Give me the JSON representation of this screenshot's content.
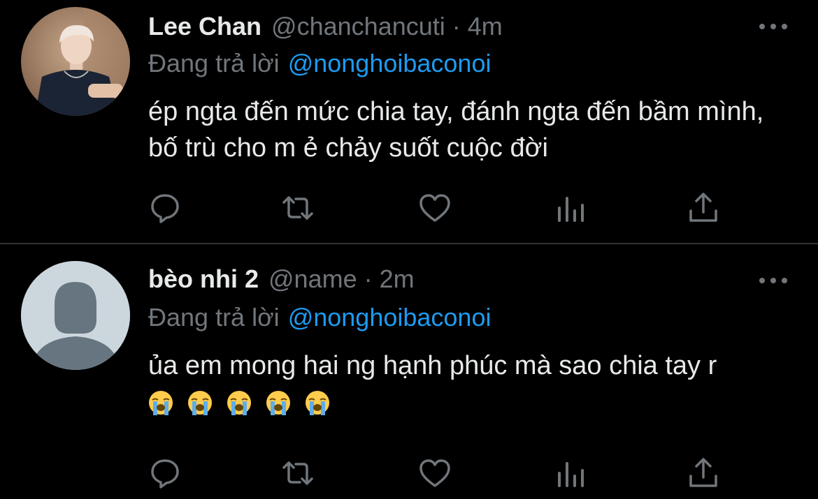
{
  "tweets": [
    {
      "name": "Lee Chan",
      "handle": "@chanchancuti",
      "separator": "·",
      "time": "4m",
      "reply_prefix": "Đang trả lời",
      "reply_to": "@nonghoibaconoi",
      "text": "ép ngta đến mức chia tay, đánh ngta đến bầm mình, bố trù cho m ẻ chảy suốt cuộc đời",
      "avatar": "profile-photo"
    },
    {
      "name": "bèo nhi 2",
      "handle": "@name",
      "separator": "·",
      "time": "2m",
      "reply_prefix": "Đang trả lời",
      "reply_to": "@nonghoibaconoi",
      "text": "ủa em mong hai ng hạnh phúc mà sao chia tay r",
      "emojis": [
        "loudly-crying-face",
        "loudly-crying-face",
        "loudly-crying-face",
        "loudly-crying-face",
        "loudly-crying-face"
      ],
      "avatar": "default-avatar"
    }
  ],
  "colors": {
    "background": "#000000",
    "text": "#e7e9ea",
    "secondary": "#71767b",
    "link": "#1d9bf0",
    "divider": "#2f3336"
  },
  "icons": [
    "more-icon",
    "reply-icon",
    "retweet-icon",
    "like-icon",
    "views-icon",
    "share-icon"
  ]
}
